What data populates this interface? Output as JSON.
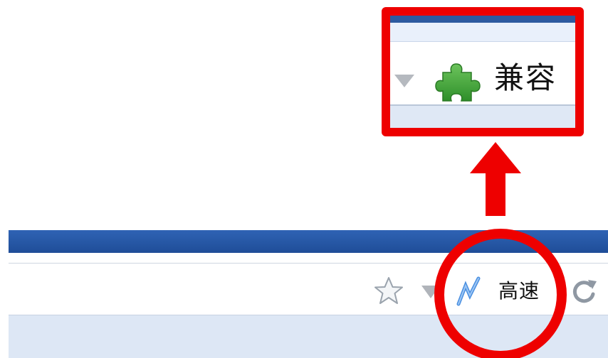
{
  "zoom_inset": {
    "mode_label": "兼容",
    "mode_icon": "puzzle-piece-icon",
    "dropdown_icon": "dropdown-triangle-icon"
  },
  "toolbar": {
    "star_icon": "star-icon",
    "dropdown_icon": "dropdown-triangle-icon",
    "engine_icon": "lightning-bolt-icon",
    "engine_label": "高速",
    "reload_icon": "reload-icon"
  },
  "annotation": {
    "highlight_color": "#ee0000",
    "arrow_direction": "up"
  },
  "colors": {
    "title_bar": "#2f63b4",
    "bookmarks_band": "#dde7f5",
    "puzzle_green": "#3ea53a",
    "bolt_blue": "#4a8fe0"
  }
}
